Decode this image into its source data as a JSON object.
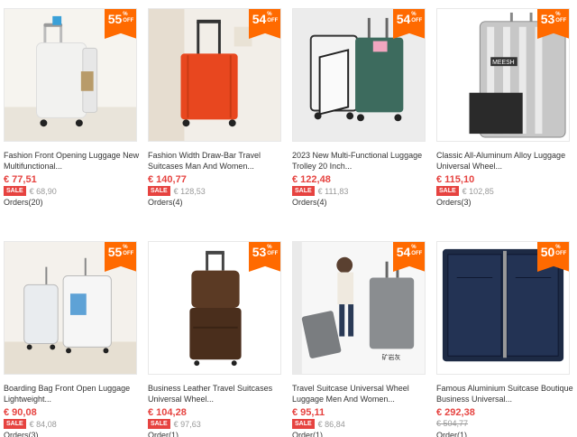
{
  "products": [
    {
      "discount": "55",
      "title1": "Fashion Front Opening Luggage New",
      "title2": "Multifunctional...",
      "price": "€ 77,51",
      "sale": "SALE",
      "old_price": "€ 68,90",
      "orders": "Orders(20)",
      "color": "#f2f2f0"
    },
    {
      "discount": "54",
      "title1": "Fashion Width Draw-Bar Travel",
      "title2": "Suitcases Man And Women...",
      "price": "€ 140,77",
      "sale": "SALE",
      "old_price": "€ 128,53",
      "orders": "Orders(4)",
      "color": "#e8471f"
    },
    {
      "discount": "54",
      "title1": "2023 New Multi-Functional Luggage",
      "title2": "Trolley 20 Inch...",
      "price": "€ 122,48",
      "sale": "SALE",
      "old_price": "€ 111,83",
      "orders": "Orders(4)",
      "color": "#3d6b5e"
    },
    {
      "discount": "53",
      "title1": "Classic All-Aluminum Alloy Luggage",
      "title2": "Universal Wheel...",
      "price": "€ 115,10",
      "sale": "SALE",
      "old_price": "€ 102,85",
      "orders": "Orders(3)",
      "color": "#c7c7c7"
    },
    {
      "discount": "55",
      "title1": "Boarding Bag Front Open Luggage",
      "title2": "Lightweight...",
      "price": "€ 90,08",
      "sale": "SALE",
      "old_price": "€ 84,08",
      "orders": "Orders(3)",
      "color": "#e9ecef"
    },
    {
      "discount": "53",
      "title1": "Business Leather Travel Suitcases",
      "title2": "Universal Wheel...",
      "price": "€ 104,28",
      "sale": "SALE",
      "old_price": "€ 97,63",
      "orders": "Order(1)",
      "color": "#5b3a24"
    },
    {
      "discount": "54",
      "title1": "Travel Suitcase Universal Wheel",
      "title2": "Luggage Men And Women...",
      "price": "€ 95,11",
      "sale": "SALE",
      "old_price": "€ 86,84",
      "orders": "Order(1)",
      "color": "#7a7d80"
    },
    {
      "discount": "50",
      "title1": "Famous Aluminium Suitcase Boutique",
      "title2": "Business Universal...",
      "price": "€ 292,38",
      "sale": "",
      "old_price": "€ 504,77",
      "orders": "Order(1)",
      "color": "#1d2a44"
    }
  ],
  "badge_pct_symbol": "%",
  "badge_off_label": "OFF",
  "image_caption": "矿岩灰",
  "image_brand_mark": "MEESH"
}
